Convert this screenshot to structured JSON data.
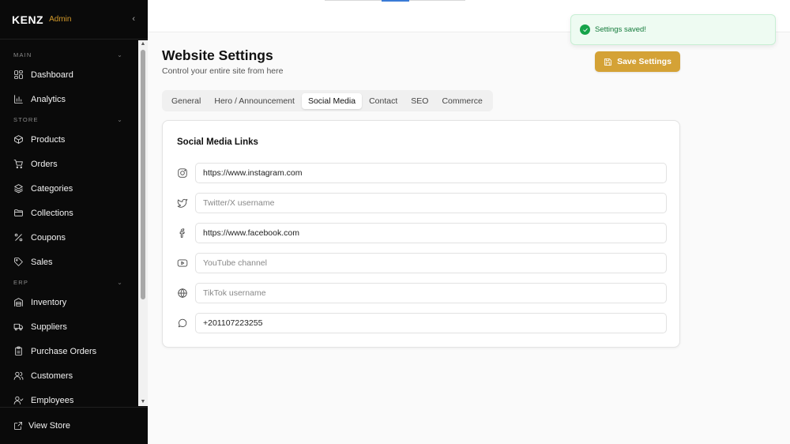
{
  "app": {
    "brand": "KENZ",
    "brand_sub": "Admin",
    "collapse_glyph": "‹"
  },
  "sidebar": {
    "sections": [
      {
        "header": "MAIN",
        "items": [
          {
            "label": "Dashboard",
            "icon": "dashboard-icon"
          },
          {
            "label": "Analytics",
            "icon": "chart-icon"
          }
        ]
      },
      {
        "header": "STORE",
        "items": [
          {
            "label": "Products",
            "icon": "box-icon"
          },
          {
            "label": "Orders",
            "icon": "cart-icon"
          },
          {
            "label": "Categories",
            "icon": "layers-icon"
          },
          {
            "label": "Collections",
            "icon": "folder-icon"
          },
          {
            "label": "Coupons",
            "icon": "percent-icon"
          },
          {
            "label": "Sales",
            "icon": "tag-icon"
          }
        ]
      },
      {
        "header": "ERP",
        "items": [
          {
            "label": "Inventory",
            "icon": "warehouse-icon"
          },
          {
            "label": "Suppliers",
            "icon": "truck-icon"
          },
          {
            "label": "Purchase Orders",
            "icon": "clipboard-icon"
          },
          {
            "label": "Customers",
            "icon": "users-icon"
          },
          {
            "label": "Employees",
            "icon": "user-check-icon"
          }
        ]
      }
    ],
    "view_store": "View Store"
  },
  "page": {
    "title": "Website Settings",
    "subtitle": "Control your entire site from here",
    "save_label": "Save Settings"
  },
  "tabs": [
    {
      "label": "General",
      "active": false
    },
    {
      "label": "Hero / Announcement",
      "active": false
    },
    {
      "label": "Social Media",
      "active": true
    },
    {
      "label": "Contact",
      "active": false
    },
    {
      "label": "SEO",
      "active": false
    },
    {
      "label": "Commerce",
      "active": false
    }
  ],
  "social": {
    "title": "Social Media Links",
    "fields": [
      {
        "icon": "instagram-icon",
        "value": "https://www.instagram.com",
        "placeholder": ""
      },
      {
        "icon": "twitter-icon",
        "value": "",
        "placeholder": "Twitter/X username"
      },
      {
        "icon": "facebook-icon",
        "value": "https://www.facebook.com",
        "placeholder": ""
      },
      {
        "icon": "youtube-icon",
        "value": "",
        "placeholder": "YouTube channel"
      },
      {
        "icon": "globe-icon",
        "value": "",
        "placeholder": "TikTok username"
      },
      {
        "icon": "whatsapp-icon",
        "value": "+201107223255",
        "placeholder": ""
      }
    ]
  },
  "toast": {
    "message": "Settings saved!",
    "status_color": "#16a34a"
  },
  "colors": {
    "accent": "#d4a236",
    "sidebar_bg": "#0a0a0a"
  }
}
